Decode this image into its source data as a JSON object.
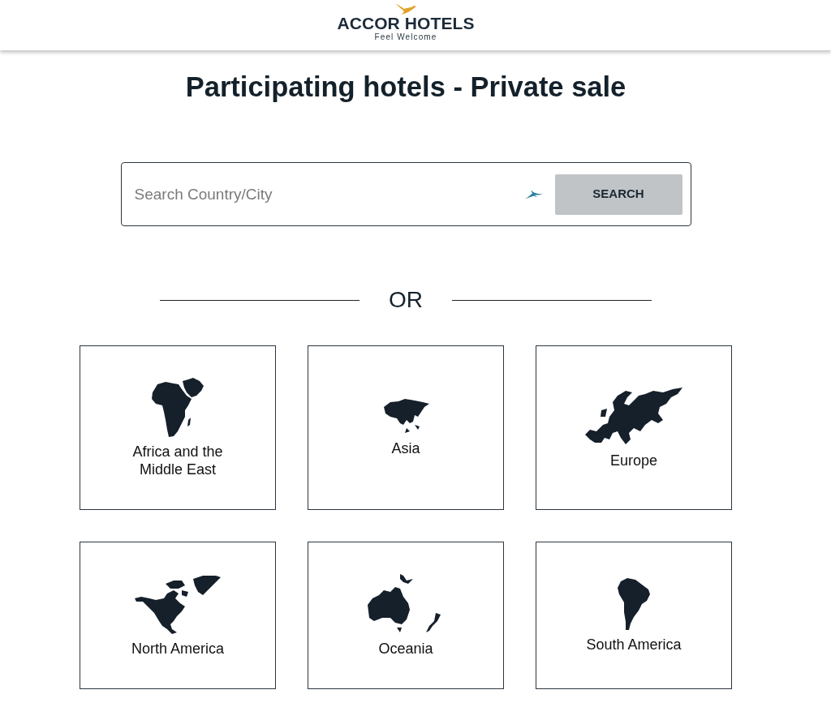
{
  "header": {
    "brand": "ACCOR HOTELS",
    "tagline": "Feel Welcome"
  },
  "title": "Participating hotels - Private sale",
  "search": {
    "placeholder": "Search Country/City",
    "button": "SEARCH"
  },
  "divider": {
    "label": "OR"
  },
  "regions": [
    {
      "name": "Africa and the Middle East",
      "kind": "africa"
    },
    {
      "name": "Asia",
      "kind": "asia"
    },
    {
      "name": "Europe",
      "kind": "europe"
    },
    {
      "name": "North America",
      "kind": "north_america"
    },
    {
      "name": "Oceania",
      "kind": "oceania"
    },
    {
      "name": "South America",
      "kind": "south_america"
    }
  ]
}
